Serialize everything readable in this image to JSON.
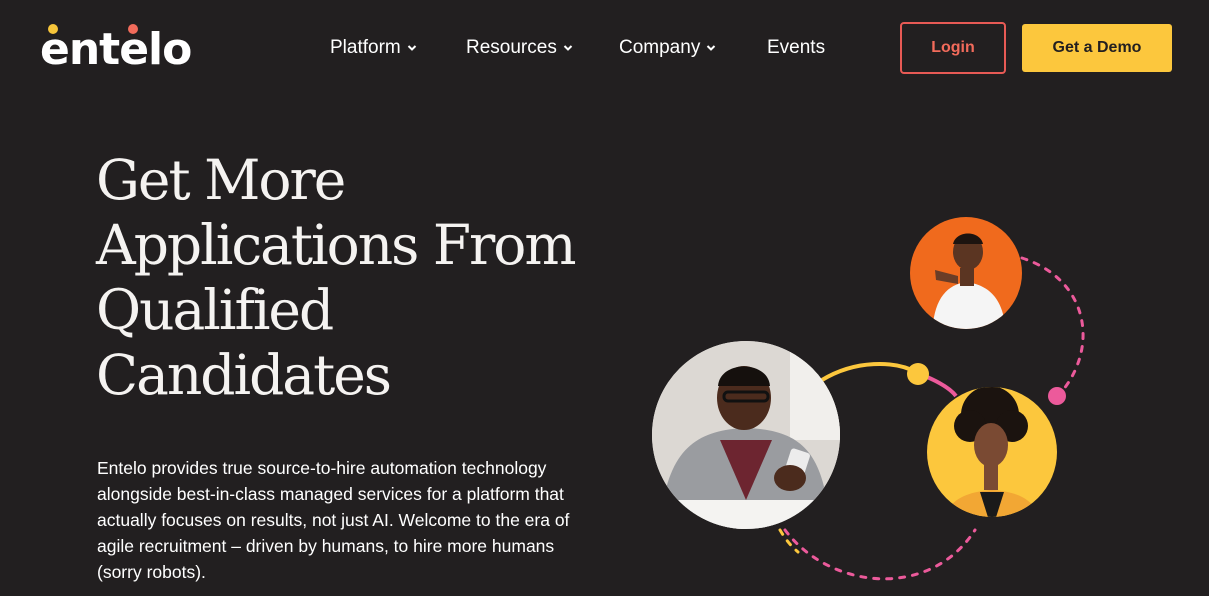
{
  "brand": {
    "name": "entelo",
    "dot_colors": {
      "primary": "#f7c53a",
      "secondary": "#f26b5b"
    }
  },
  "nav": {
    "items": [
      {
        "label": "Platform",
        "has_dropdown": true
      },
      {
        "label": "Resources",
        "has_dropdown": true
      },
      {
        "label": "Company",
        "has_dropdown": true
      },
      {
        "label": "Events",
        "has_dropdown": false
      }
    ],
    "login_label": "Login",
    "demo_label": "Get a Demo"
  },
  "hero": {
    "title_lines": [
      "Get More",
      "Applications From",
      "Qualified",
      "Candidates"
    ],
    "description": "Entelo provides true source-to-hire automation technology alongside best-in-class managed services for a platform that actually focuses on results, not just AI. Welcome to the era of agile recruitment – driven by humans, to hire more humans (sorry robots)."
  },
  "colors": {
    "background": "#221f20",
    "accent_yellow": "#fcc73d",
    "accent_coral": "#e85a55",
    "accent_pink": "#ec5a9b",
    "accent_orange": "#f06a1d"
  },
  "illustration": {
    "people": [
      "person-pointing-photo",
      "person-with-phone-photo",
      "person-smiling-photo"
    ]
  }
}
